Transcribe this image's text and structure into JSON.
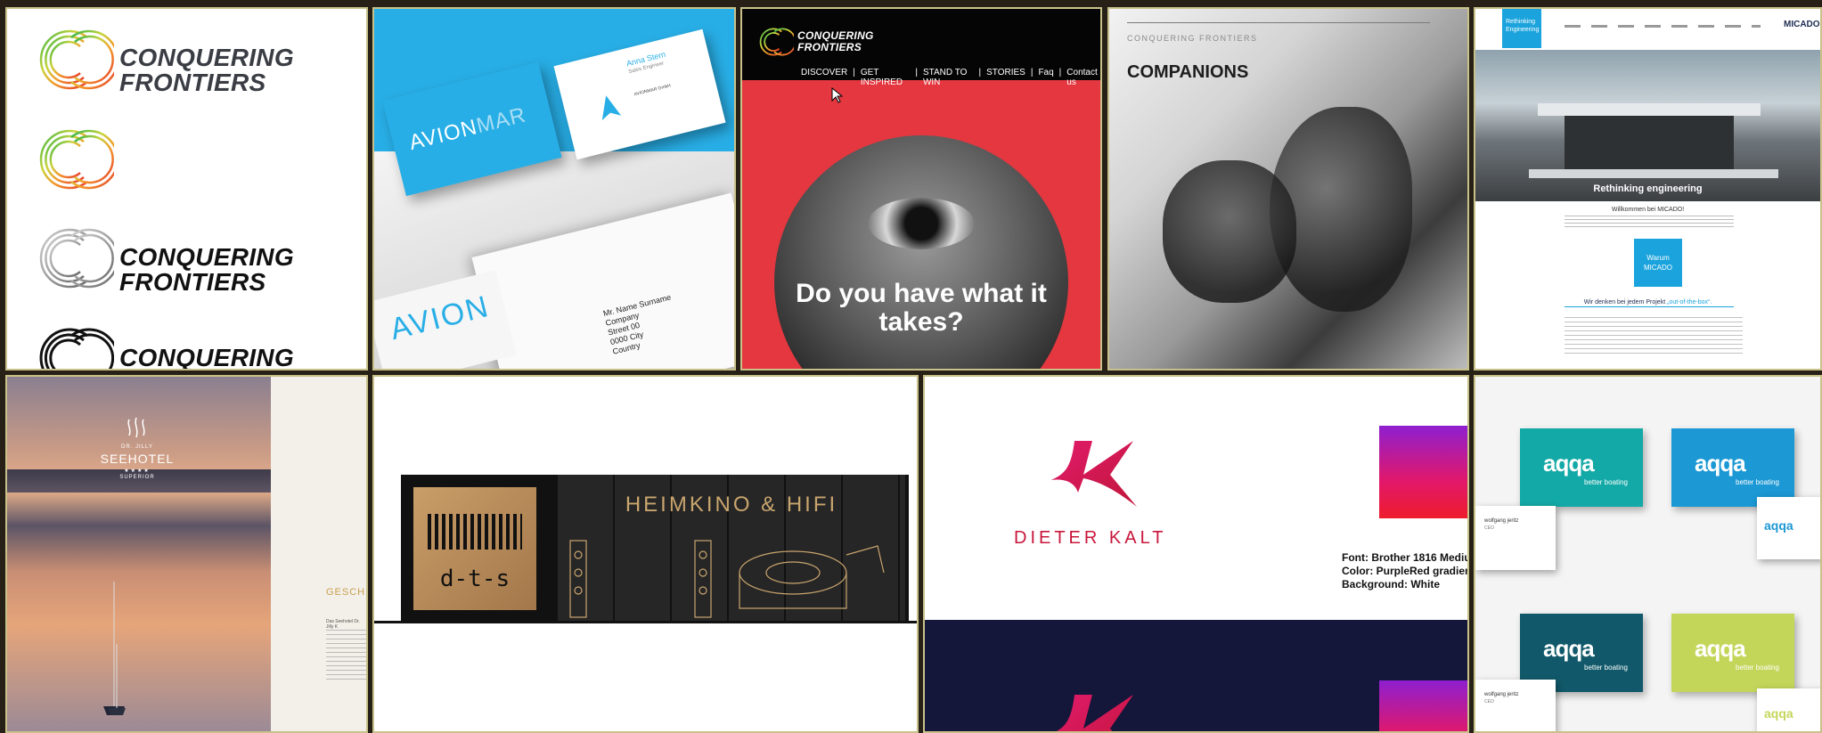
{
  "tiles": {
    "conquering_frontiers_logos": {
      "line1": "CONQUERING",
      "line2": "FRONTIERS",
      "line3": "CONQUERING",
      "line4": "FRONTIERS",
      "line5": "CONQUERING"
    },
    "avionmar": {
      "brand_a": "AVION",
      "brand_b": "MAR",
      "card_name": "Anna Stern",
      "card_role": "Sales Engineer",
      "card_company": "AVIONMAR GmbH",
      "address_lines": [
        "Mr. Name Surname",
        "Company",
        "Street 00",
        "0000 City",
        "Country"
      ]
    },
    "conquering_site": {
      "logo_line1": "CONQUERING",
      "logo_line2": "FRONTIERS",
      "nav": [
        "DISCOVER",
        "GET INSPIRED",
        "STAND TO WIN",
        "STORIES",
        "Faq",
        "Contact us"
      ],
      "headline_line1": "Do you have what it",
      "headline_line2": "takes?"
    },
    "companions": {
      "brand": "CONQUERING FRONTIERS",
      "heading": "COMPANIONS"
    },
    "micado": {
      "badge_line1": "Rethinking",
      "badge_line2": "Engineering",
      "logo": "MICADO",
      "hero_caption": "Rethinking engineering",
      "welcome": "Willkommen bei MICADO!",
      "warum_line1": "Warum",
      "warum_line2": "MICADO",
      "think_prefix": "Wir denken bei jedem Projekt ",
      "think_highlight": "„out-of-the-box“."
    },
    "seehotel": {
      "brand_small": "DR. JILLY",
      "brand": "SEEHOTEL",
      "stars": "★★★★",
      "tier": "SUPERIOR",
      "side_heading": "GESCHICH",
      "side_text": "Das Seehotel Dr. Jilly K"
    },
    "dts": {
      "logo": "d-t-s",
      "sign": "HEIMKINO & HIFI"
    },
    "dieter_kalt": {
      "brand": "DIETER KALT",
      "spec_font": "Font: Brother 1816 Mediu",
      "spec_color": "Color: PurpleRed gradien",
      "spec_bg": "Background: White"
    },
    "aqqa": {
      "logo": "aqqa",
      "tagline": "better boating",
      "card_name": "wolfgang jeritz",
      "card_role": "CEO"
    }
  },
  "colors": {
    "avion_blue": "#28aee6",
    "red_bg": "#e4373f",
    "micado_blue": "#1aa3dc",
    "dieter_navy": "#14163a",
    "aqqa_teal": "#13a9a6",
    "aqqa_blue": "#1c98d4",
    "aqqa_dark": "#11596a",
    "aqqa_lime": "#c4d65a"
  }
}
